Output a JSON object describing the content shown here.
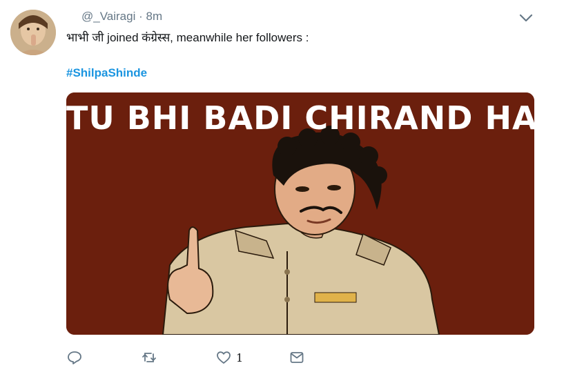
{
  "tweet": {
    "handle": "@_Vairagi",
    "separator": "·",
    "time": "8m",
    "text": "भाभी जी joined कंग्रेस्स, meanwhile her followers :",
    "hashtag": "#ShilpaShinde"
  },
  "media": {
    "caption": "TU BHI BADI CHIRAND HAI",
    "background_color": "#6b1f0d"
  },
  "actions": {
    "reply_icon": "reply-icon",
    "retweet_icon": "retweet-icon",
    "like_icon": "heart-icon",
    "like_count": "1",
    "dm_icon": "envelope-icon"
  },
  "colors": {
    "link": "#1b95e0",
    "secondary_text": "#657786",
    "icon": "#657786"
  }
}
